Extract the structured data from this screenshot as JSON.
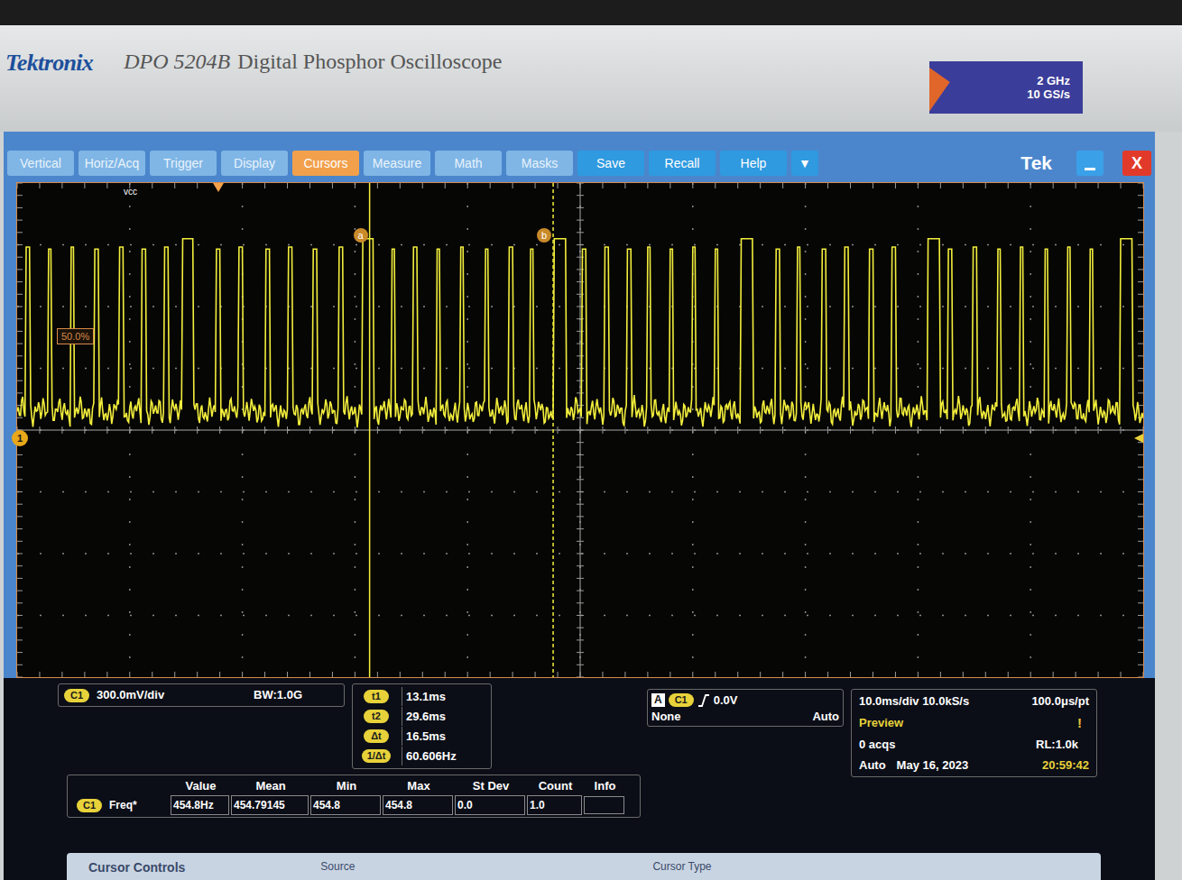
{
  "bezel": {
    "brand": "Tektronix",
    "model": "DPO 5204B",
    "description": "Digital Phosphor Oscilloscope",
    "spec_bandwidth": "2 GHz",
    "spec_rate": "10 GS/s"
  },
  "menu": [
    {
      "label": "Vertical",
      "selected": false
    },
    {
      "label": "Horiz/Acq",
      "selected": false
    },
    {
      "label": "Trigger",
      "selected": false
    },
    {
      "label": "Display",
      "selected": false
    },
    {
      "label": "Cursors",
      "selected": true
    },
    {
      "label": "Measure",
      "selected": false
    },
    {
      "label": "Math",
      "selected": false
    },
    {
      "label": "Masks",
      "selected": false
    },
    {
      "label": "Save",
      "selected": false
    },
    {
      "label": "Recall",
      "selected": false
    },
    {
      "label": "Help",
      "selected": false
    },
    {
      "label": "▼",
      "selected": false
    }
  ],
  "window": {
    "title": "Tek",
    "close": "X"
  },
  "graticule": {
    "channel_label": "vcc",
    "trigger_level": "50.0%",
    "ground_marker": "1",
    "baseline_v": 0.13,
    "cursors": [
      {
        "label": "a",
        "position_ms": 31.3,
        "style": "solid"
      },
      {
        "label": "b",
        "position_ms": 47.6,
        "style": "dashed"
      }
    ],
    "pulses": [
      {
        "t_ms": 0.8,
        "width_ms": 0.3,
        "peak_v": 0.93
      },
      {
        "t_ms": 2.8,
        "width_ms": 0.3,
        "peak_v": 0.92
      },
      {
        "t_ms": 4.8,
        "width_ms": 0.3,
        "peak_v": 0.93
      },
      {
        "t_ms": 6.9,
        "width_ms": 0.3,
        "peak_v": 0.92
      },
      {
        "t_ms": 9.1,
        "width_ms": 0.3,
        "peak_v": 0.93
      },
      {
        "t_ms": 11.1,
        "width_ms": 0.3,
        "peak_v": 0.92
      },
      {
        "t_ms": 13.1,
        "width_ms": 0.3,
        "peak_v": 0.93
      },
      {
        "t_ms": 14.7,
        "width_ms": 1.0,
        "peak_v": 0.97
      },
      {
        "t_ms": 17.7,
        "width_ms": 0.3,
        "peak_v": 0.92
      },
      {
        "t_ms": 19.7,
        "width_ms": 0.3,
        "peak_v": 0.93
      },
      {
        "t_ms": 22.1,
        "width_ms": 0.3,
        "peak_v": 0.92
      },
      {
        "t_ms": 24.1,
        "width_ms": 0.3,
        "peak_v": 0.93
      },
      {
        "t_ms": 26.3,
        "width_ms": 0.3,
        "peak_v": 0.92
      },
      {
        "t_ms": 28.6,
        "width_ms": 0.3,
        "peak_v": 0.93
      },
      {
        "t_ms": 30.7,
        "width_ms": 1.0,
        "peak_v": 0.97
      },
      {
        "t_ms": 33.3,
        "width_ms": 0.3,
        "peak_v": 0.92
      },
      {
        "t_ms": 35.2,
        "width_ms": 0.3,
        "peak_v": 0.93
      },
      {
        "t_ms": 37.3,
        "width_ms": 0.3,
        "peak_v": 0.92
      },
      {
        "t_ms": 39.4,
        "width_ms": 0.3,
        "peak_v": 0.93
      },
      {
        "t_ms": 41.6,
        "width_ms": 0.3,
        "peak_v": 0.92
      },
      {
        "t_ms": 43.7,
        "width_ms": 0.3,
        "peak_v": 0.93
      },
      {
        "t_ms": 45.6,
        "width_ms": 0.3,
        "peak_v": 0.92
      },
      {
        "t_ms": 47.7,
        "width_ms": 1.0,
        "peak_v": 0.97
      },
      {
        "t_ms": 50.2,
        "width_ms": 0.3,
        "peak_v": 0.92
      },
      {
        "t_ms": 52.2,
        "width_ms": 0.3,
        "peak_v": 0.93
      },
      {
        "t_ms": 54.2,
        "width_ms": 0.3,
        "peak_v": 0.92
      },
      {
        "t_ms": 56.0,
        "width_ms": 0.3,
        "peak_v": 0.93
      },
      {
        "t_ms": 58.0,
        "width_ms": 0.3,
        "peak_v": 0.92
      },
      {
        "t_ms": 60.0,
        "width_ms": 0.3,
        "peak_v": 0.93
      },
      {
        "t_ms": 62.0,
        "width_ms": 0.3,
        "peak_v": 0.92
      },
      {
        "t_ms": 64.3,
        "width_ms": 1.0,
        "peak_v": 0.97
      },
      {
        "t_ms": 67.4,
        "width_ms": 0.3,
        "peak_v": 0.92
      },
      {
        "t_ms": 69.3,
        "width_ms": 0.3,
        "peak_v": 0.93
      },
      {
        "t_ms": 71.5,
        "width_ms": 0.3,
        "peak_v": 0.92
      },
      {
        "t_ms": 73.5,
        "width_ms": 0.3,
        "peak_v": 0.93
      },
      {
        "t_ms": 75.7,
        "width_ms": 0.3,
        "peak_v": 0.92
      },
      {
        "t_ms": 77.7,
        "width_ms": 0.3,
        "peak_v": 0.93
      },
      {
        "t_ms": 80.9,
        "width_ms": 1.0,
        "peak_v": 0.97
      },
      {
        "t_ms": 82.7,
        "width_ms": 0.3,
        "peak_v": 0.92
      },
      {
        "t_ms": 84.9,
        "width_ms": 0.3,
        "peak_v": 0.93
      },
      {
        "t_ms": 87.1,
        "width_ms": 0.3,
        "peak_v": 0.92
      },
      {
        "t_ms": 89.1,
        "width_ms": 0.3,
        "peak_v": 0.93
      },
      {
        "t_ms": 91.3,
        "width_ms": 0.3,
        "peak_v": 0.92
      },
      {
        "t_ms": 93.3,
        "width_ms": 0.3,
        "peak_v": 0.93
      },
      {
        "t_ms": 95.3,
        "width_ms": 0.3,
        "peak_v": 0.92
      },
      {
        "t_ms": 98.0,
        "width_ms": 1.0,
        "peak_v": 0.97
      }
    ]
  },
  "channel": {
    "badge": "C1",
    "scale": "300.0mV/div",
    "bandwidth": "BW:1.0G"
  },
  "cursor_readouts": [
    {
      "label": "t1",
      "value": "13.1ms"
    },
    {
      "label": "t2",
      "value": "29.6ms"
    },
    {
      "label": "Δt",
      "value": "16.5ms"
    },
    {
      "label": "1/Δt",
      "value": "60.606Hz"
    }
  ],
  "trigger": {
    "badge": "A",
    "source": "C1",
    "level": "0.0V",
    "coupling": "None",
    "mode": "Auto"
  },
  "horizontal": {
    "scale": "10.0ms/div",
    "rate": "10.0kS/s",
    "per_point": "100.0μs/pt",
    "state": "Preview",
    "warning": "!",
    "acqs": "0 acqs",
    "record_length": "RL:1.0k",
    "mode": "Auto",
    "date": "May 16, 2023",
    "time": "20:59:42"
  },
  "measurements": {
    "columns": [
      "Value",
      "Mean",
      "Min",
      "Max",
      "St Dev",
      "Count",
      "Info"
    ],
    "rows": [
      {
        "source": "C1",
        "name": "Freq*",
        "values": [
          "454.8Hz",
          "454.79145",
          "454.8",
          "454.8",
          "0.0",
          "1.0",
          ""
        ]
      }
    ]
  },
  "bottom_strip": {
    "title": "Cursor Controls",
    "labels": [
      "Source",
      "Cursor Type"
    ]
  }
}
